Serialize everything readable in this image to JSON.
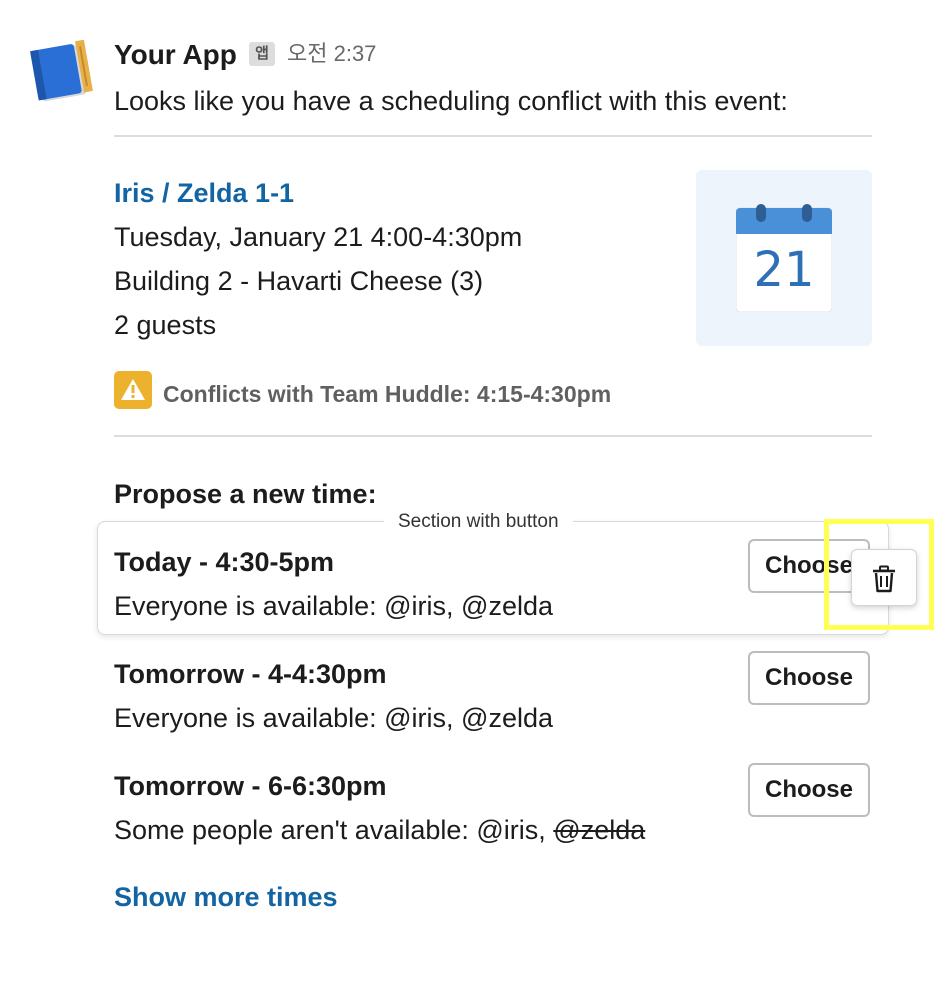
{
  "message": {
    "app_name": "Your App",
    "app_badge": "앱",
    "timestamp": "오전 2:37",
    "intro": "Looks like you have a scheduling conflict with this event:"
  },
  "event": {
    "title": "Iris / Zelda 1-1",
    "datetime": "Tuesday, January 21 4:00-4:30pm",
    "location": "Building 2 - Havarti Cheese (3)",
    "guests": "2 guests",
    "calendar_day": "21",
    "conflict": "Conflicts with Team Huddle: 4:15-4:30pm",
    "warning_icon": "warning-icon",
    "calendar_icon": "calendar-icon"
  },
  "propose": {
    "heading": "Propose a new time:",
    "section_label": "Section with button",
    "options": [
      {
        "title": "Today - 4:30-5pm",
        "desc_prefix": "Everyone is available: @iris, @zelda",
        "button": "Choose"
      },
      {
        "title": "Tomorrow - 4-4:30pm",
        "desc_prefix": "Everyone is available: @iris, @zelda",
        "button": "Choose"
      },
      {
        "title": "Tomorrow - 6-6:30pm",
        "desc_prefix": "Some people aren't available: @iris, ",
        "desc_strike": "@zelda",
        "button": "Choose"
      }
    ],
    "show_more": "Show more times"
  },
  "colors": {
    "link": "#1264a3",
    "warning": "#ecb22e",
    "calendar_bg": "#eef4fb",
    "calendar_accent": "#4a90d9",
    "highlight": "#ffff55"
  },
  "icons": {
    "delete": "trash-icon",
    "avatar": "app-avatar-book-icon"
  }
}
